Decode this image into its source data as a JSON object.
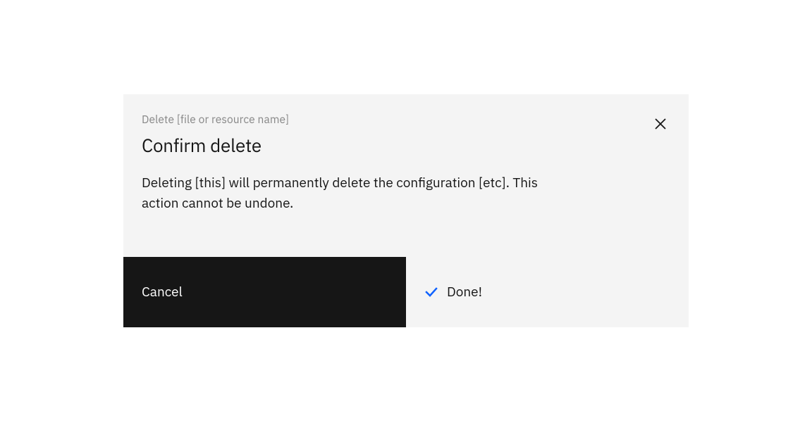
{
  "modal": {
    "label": "Delete [file or resource name]",
    "title": "Confirm delete",
    "description": "Deleting [this] will permanently delete the configuration [etc]. This action cannot be undone.",
    "cancel_label": "Cancel",
    "done_label": "Done!"
  },
  "colors": {
    "checkmark": "#0f62fe",
    "close_icon": "#161616"
  }
}
